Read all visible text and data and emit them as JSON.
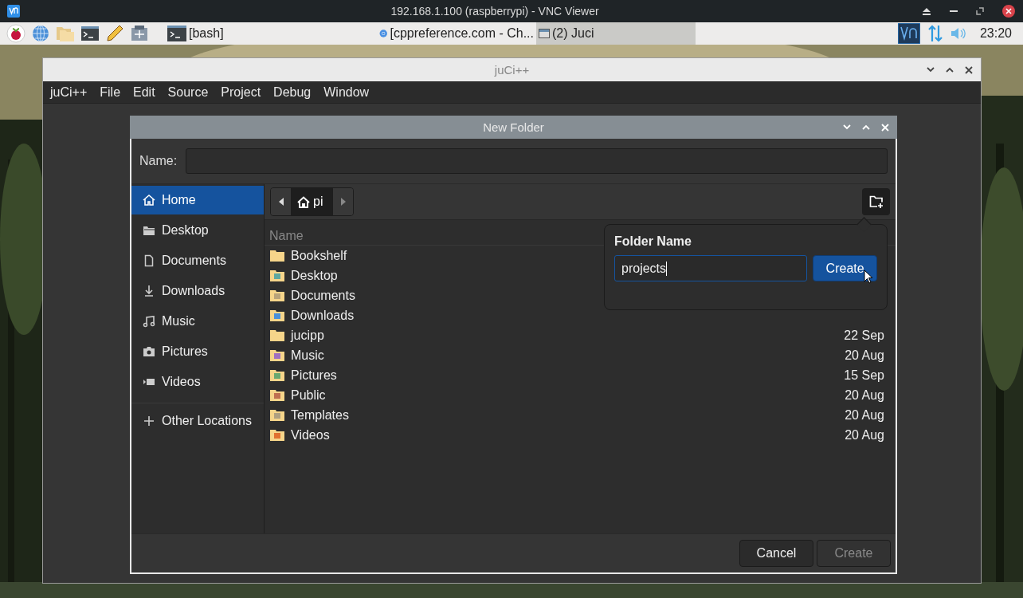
{
  "vnc_window": {
    "title": "192.168.1.100 (raspberrypi) - VNC Viewer"
  },
  "taskbar": {
    "tasks": [
      {
        "label": "[bash]",
        "kind": "terminal",
        "selected": false
      },
      {
        "label": "[cppreference.com - Ch...",
        "kind": "browser",
        "selected": false
      },
      {
        "label": "(2) Juci",
        "kind": "window",
        "selected": true
      }
    ],
    "clock": "23:20"
  },
  "app_window": {
    "title": "juCi++",
    "menu": [
      "juCi++",
      "File",
      "Edit",
      "Source",
      "Project",
      "Debug",
      "Window"
    ]
  },
  "dialog": {
    "title": "New Folder",
    "name_label": "Name:",
    "sidebar": [
      {
        "label": "Home",
        "kind": "home",
        "selected": true
      },
      {
        "label": "Desktop",
        "kind": "folder",
        "selected": false
      },
      {
        "label": "Documents",
        "kind": "document",
        "selected": false
      },
      {
        "label": "Downloads",
        "kind": "download",
        "selected": false
      },
      {
        "label": "Music",
        "kind": "music",
        "selected": false
      },
      {
        "label": "Pictures",
        "kind": "camera",
        "selected": false
      },
      {
        "label": "Videos",
        "kind": "video",
        "selected": false
      },
      {
        "label": "Other Locations",
        "kind": "plus",
        "selected": false
      }
    ],
    "path": {
      "segment": "pi"
    },
    "columns": [
      "Name"
    ],
    "rows": [
      {
        "name": "Bookshelf",
        "kind": "plain"
      },
      {
        "name": "Desktop",
        "kind": "desktop"
      },
      {
        "name": "Documents",
        "kind": "documents"
      },
      {
        "name": "Downloads",
        "kind": "downloads"
      },
      {
        "name": "jucipp",
        "kind": "plain",
        "date": "22 Sep"
      },
      {
        "name": "Music",
        "kind": "music",
        "date": "20 Aug"
      },
      {
        "name": "Pictures",
        "kind": "pictures",
        "date": "15 Sep"
      },
      {
        "name": "Public",
        "kind": "public",
        "date": "20 Aug"
      },
      {
        "name": "Templates",
        "kind": "templates",
        "date": "20 Aug"
      },
      {
        "name": "Videos",
        "kind": "videos",
        "date": "20 Aug"
      }
    ],
    "popover": {
      "title": "Folder Name",
      "value": "projects",
      "button": "Create"
    },
    "buttons": [
      {
        "label": "Cancel",
        "disabled": false
      },
      {
        "label": "Create",
        "disabled": true
      }
    ]
  }
}
